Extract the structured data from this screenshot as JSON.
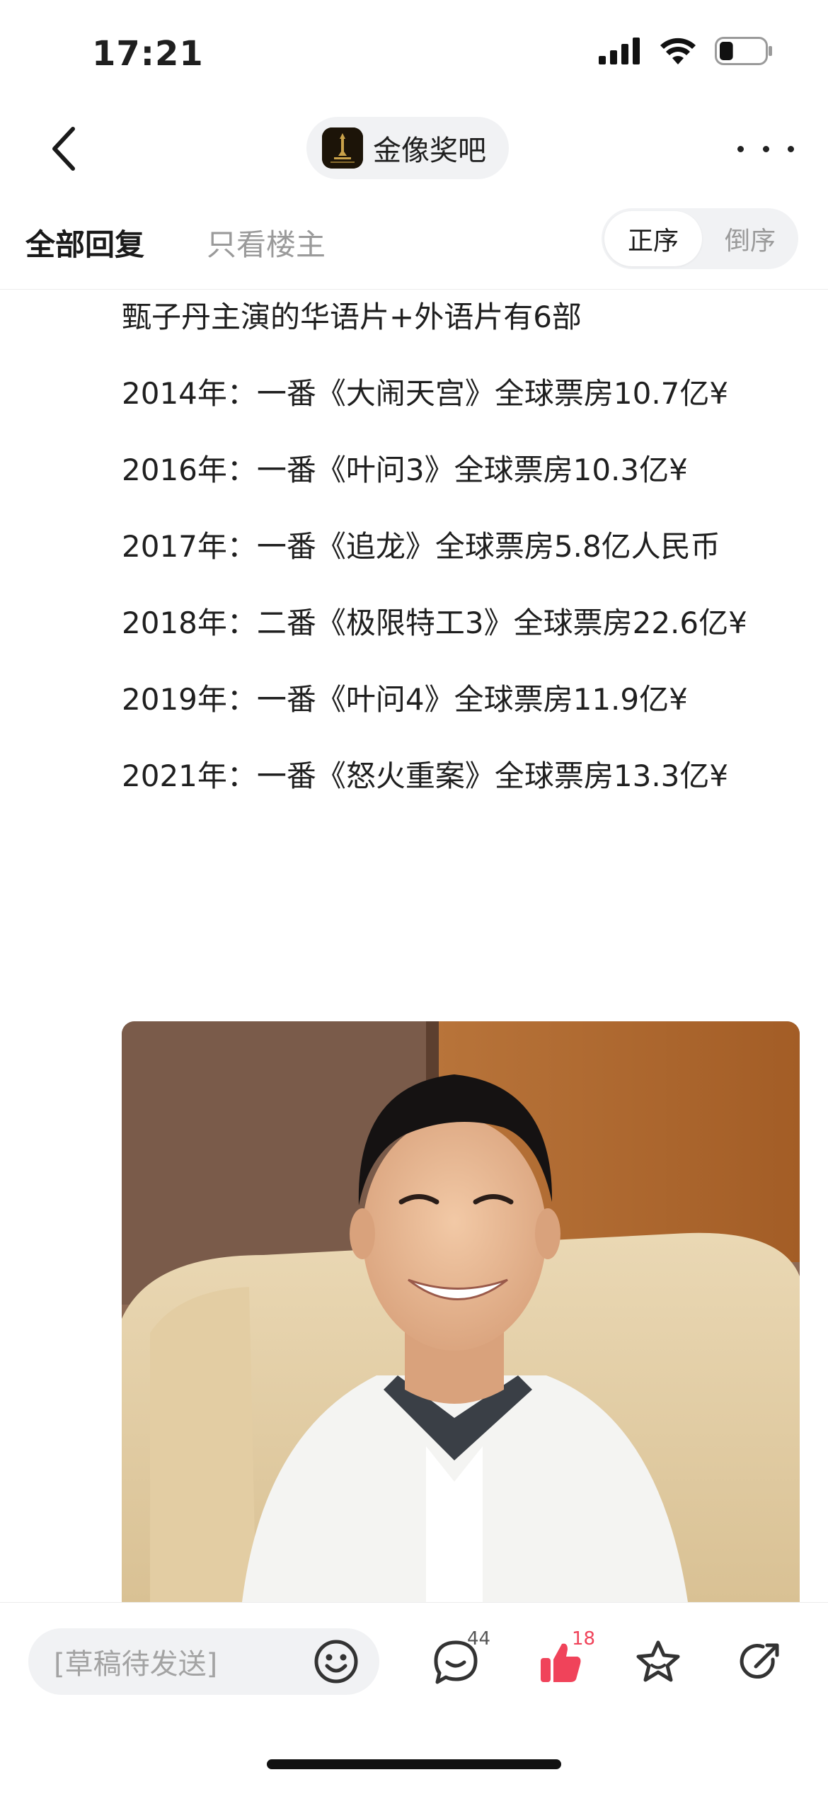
{
  "status_bar": {
    "time": "17:21",
    "icons": [
      "signal-icon",
      "wifi-icon",
      "battery-icon"
    ],
    "battery_level": 0.3
  },
  "nav": {
    "forum_name": "金像奖吧",
    "icons": [
      "back-icon",
      "more-icon"
    ]
  },
  "filters": {
    "all_replies": "全部回复",
    "op_only": "只看楼主",
    "sort_asc": "正序",
    "sort_desc": "倒序",
    "selected_sort": "正序"
  },
  "post": {
    "lines": [
      "甄子丹主演的华语片+外语片有6部",
      "2014年：一番《大闹天宫》全球票房10.7亿¥",
      "2016年：一番《叶问3》全球票房10.3亿¥",
      "2017年：一番《追龙》全球票房5.8亿人民币",
      "2018年：二番《极限特工3》全球票房22.6亿¥",
      "2019年：一番《叶问4》全球票房11.9亿¥",
      "2021年：一番《怒火重案》全球票房13.3亿¥"
    ]
  },
  "bottom_bar": {
    "draft_placeholder": "[草稿待发送]",
    "comment_count": "44",
    "like_count": "18",
    "colors": {
      "like": "#f0435a",
      "icon": "#333333",
      "count": "#555555"
    },
    "icons": [
      "emoji-icon",
      "comment-icon",
      "thumbs-up-icon",
      "star-icon",
      "share-icon"
    ]
  }
}
